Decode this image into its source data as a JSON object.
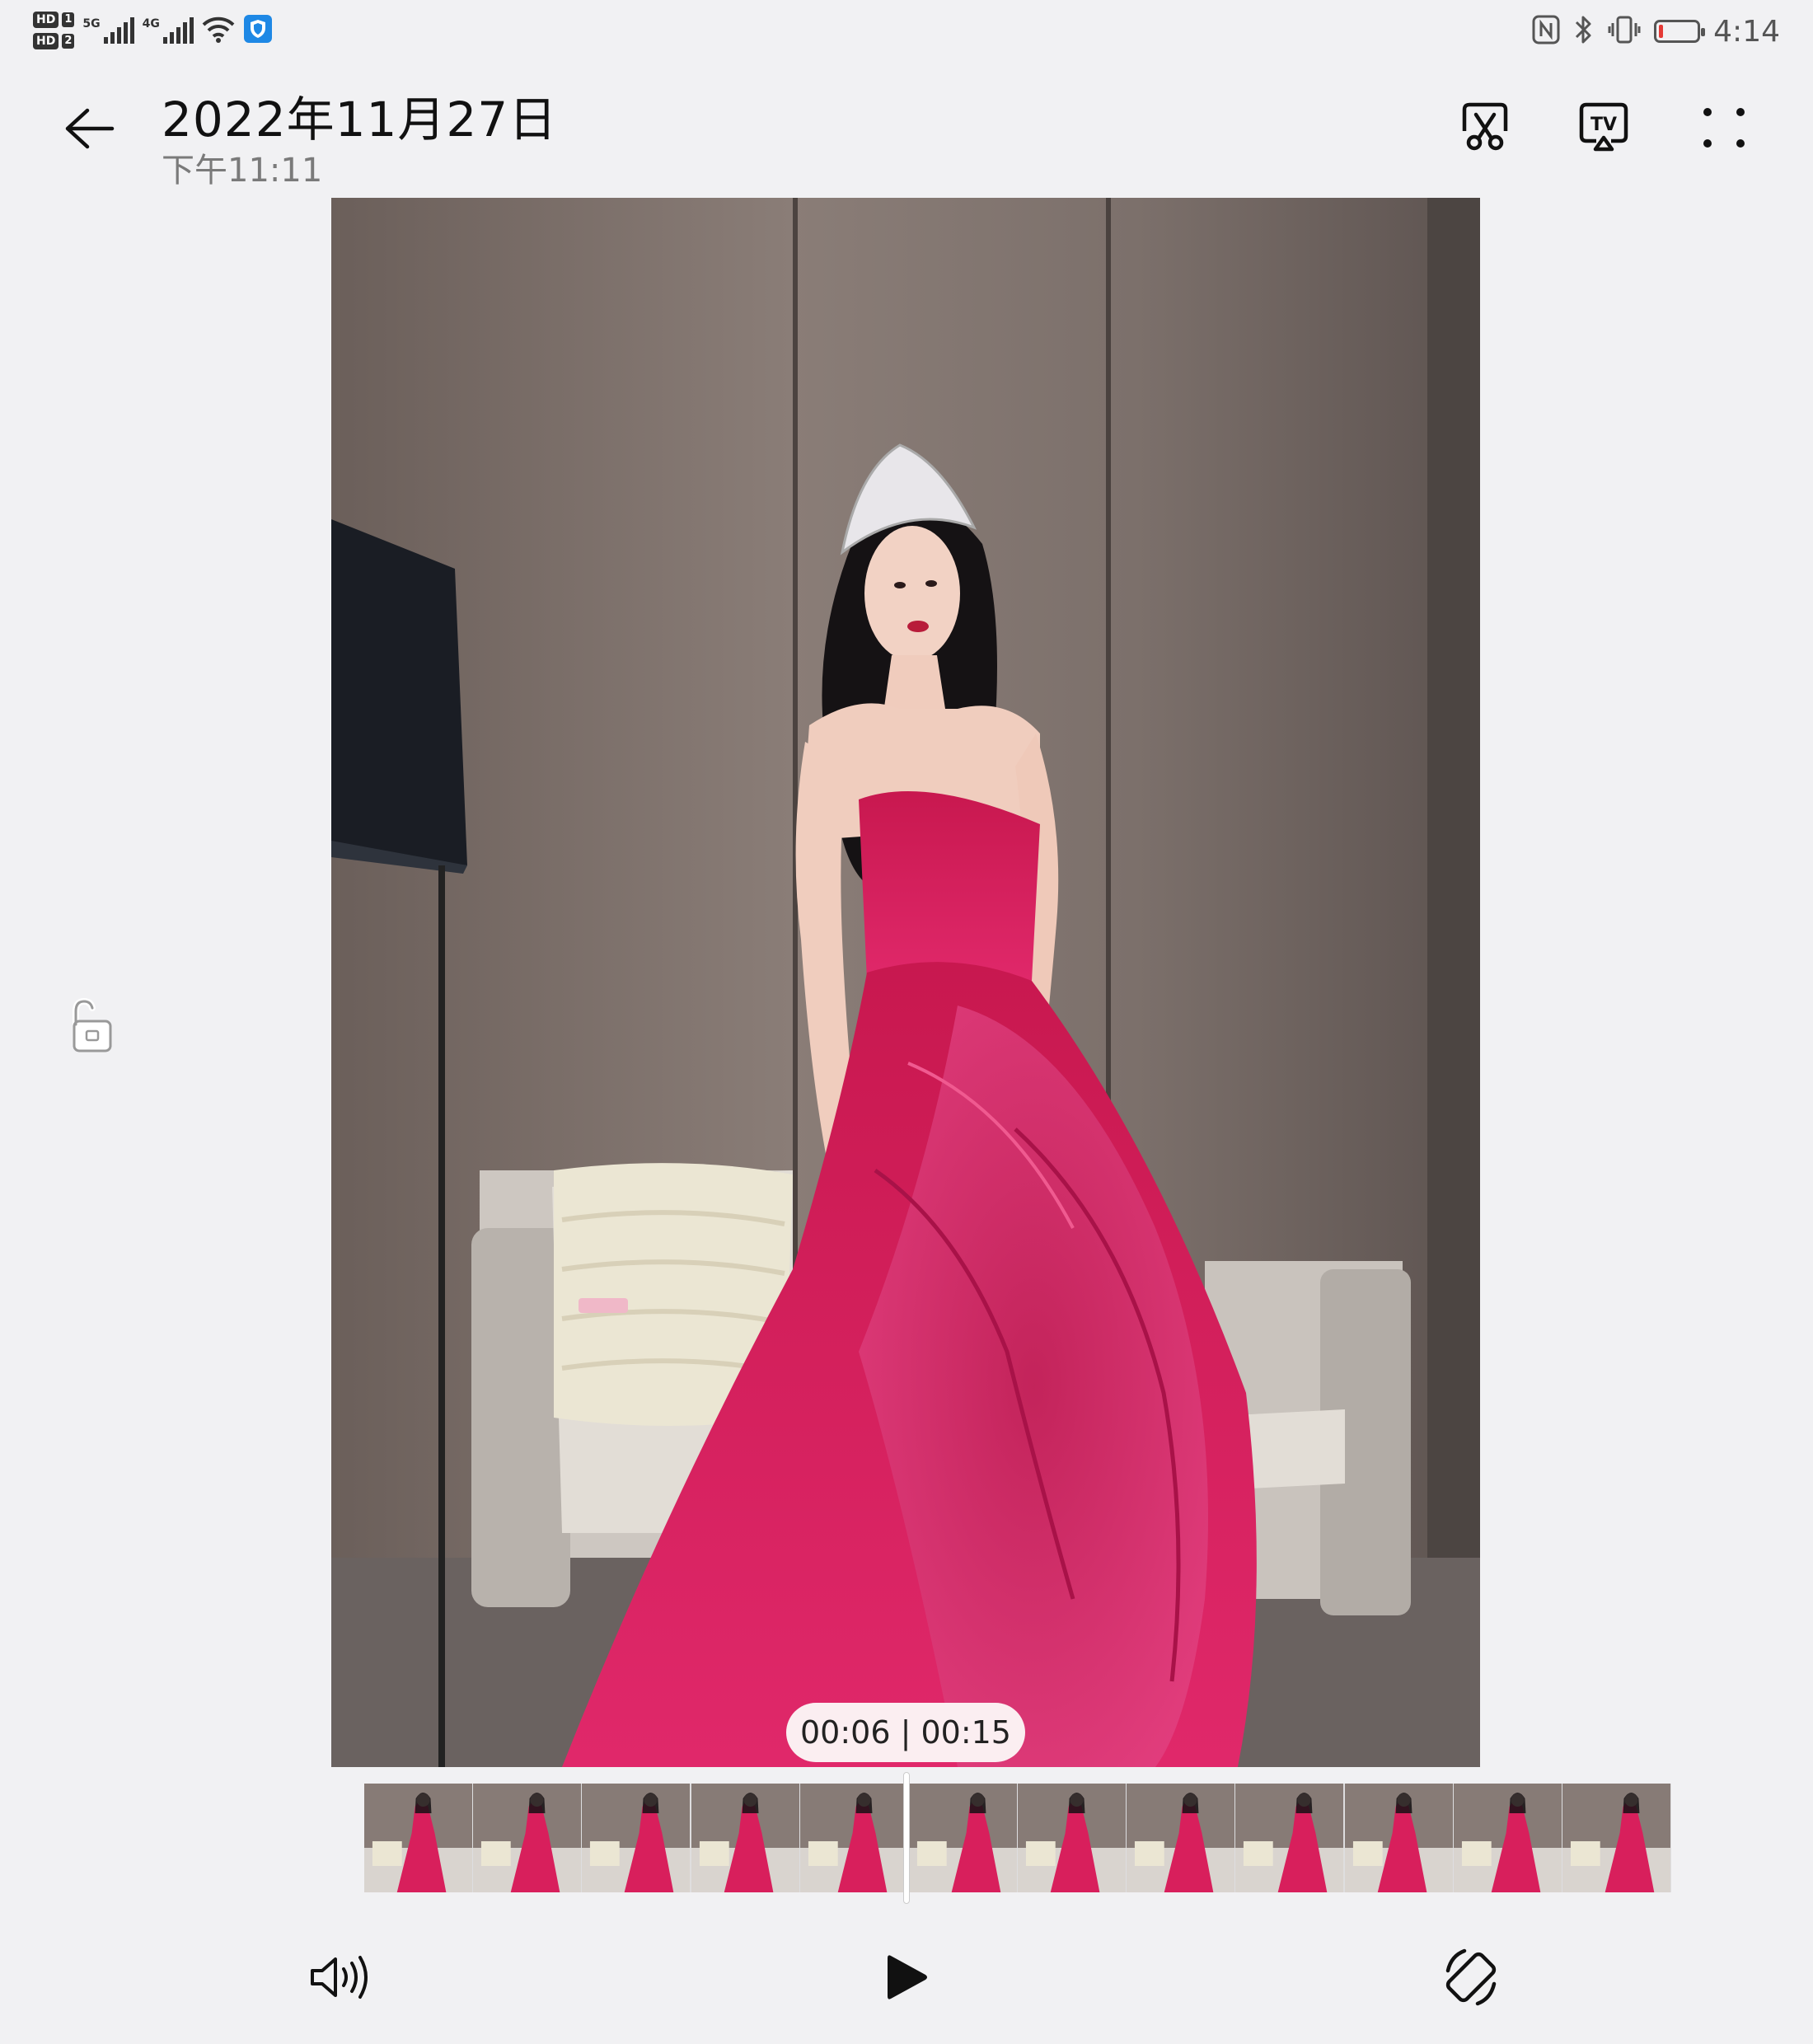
{
  "status_bar": {
    "sim1_label": "HD",
    "sim1_index": "1",
    "sim2_label": "HD",
    "sim2_index": "2",
    "net1_type": "5G",
    "net2_type": "4G",
    "time": "4:14",
    "battery_level": 0.08,
    "icons": [
      "wifi-icon",
      "vpn-shield-icon",
      "nfc-icon",
      "bluetooth-icon",
      "vibrate-icon",
      "battery-icon"
    ]
  },
  "header": {
    "title": "2022年11月27日",
    "subtitle": "下午11:11",
    "actions": [
      "edit-video-icon",
      "cast-tv-icon",
      "more-options-icon"
    ]
  },
  "player": {
    "current_time": "00:06",
    "total_time": "00:15",
    "time_display": "00:06 | 00:15",
    "progress": 0.4,
    "filmstrip_frames": 12
  },
  "controls": [
    "volume-icon",
    "play-icon",
    "rotate-screen-icon",
    "rotation-lock-icon"
  ],
  "colors": {
    "background": "#f1f1f3",
    "dress": "#d81f5c",
    "pill": "#fbeef1",
    "battery_low": "#e53935",
    "vpn_blue": "#1e88e5"
  }
}
